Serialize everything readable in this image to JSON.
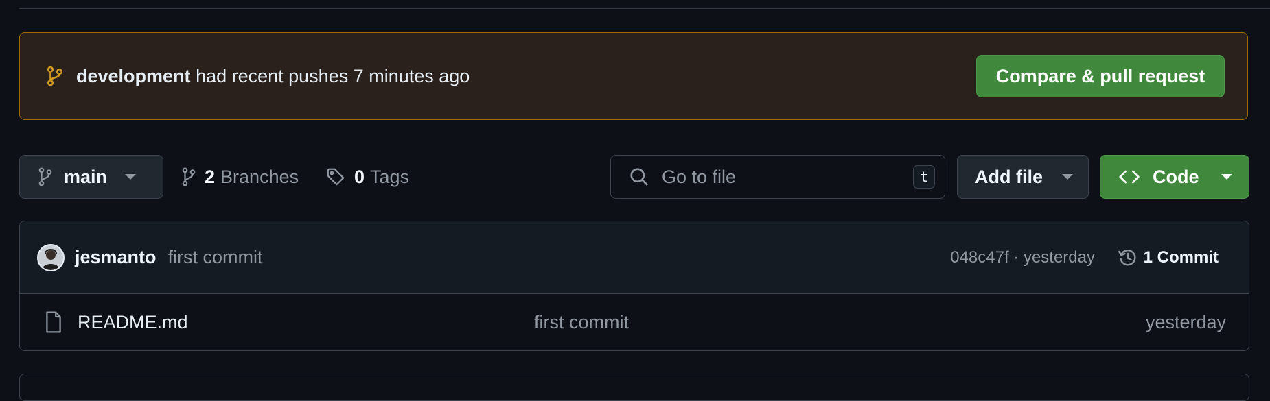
{
  "banner": {
    "branch_name": "development",
    "message": "had recent pushes 7 minutes ago",
    "compare_button": "Compare & pull request"
  },
  "toolbar": {
    "branch_select": "main",
    "branches_count": "2",
    "branches_label": "Branches",
    "tags_count": "0",
    "tags_label": "Tags",
    "search_placeholder": "Go to file",
    "search_shortcut": "t",
    "add_file": "Add file",
    "code": "Code"
  },
  "latest_commit": {
    "author": "jesmanto",
    "message": "first commit",
    "meta": "048c47f · yesterday",
    "commit_count": "1 Commit"
  },
  "files": [
    {
      "name": "README.md",
      "message": "first commit",
      "time": "yesterday"
    }
  ],
  "colors": {
    "background": "#0d1117",
    "banner_bg": "#2a211d",
    "banner_border": "#9e6a03",
    "primary_button": "#3f883c",
    "branch_icon": "#d29922"
  },
  "icons": {
    "banner": "git-branch-icon",
    "branch_select": "git-branch-icon",
    "branches": "git-branch-icon",
    "tags": "tag-icon",
    "search": "search-icon",
    "code": "code-icon",
    "history": "history-icon",
    "file": "file-icon"
  }
}
